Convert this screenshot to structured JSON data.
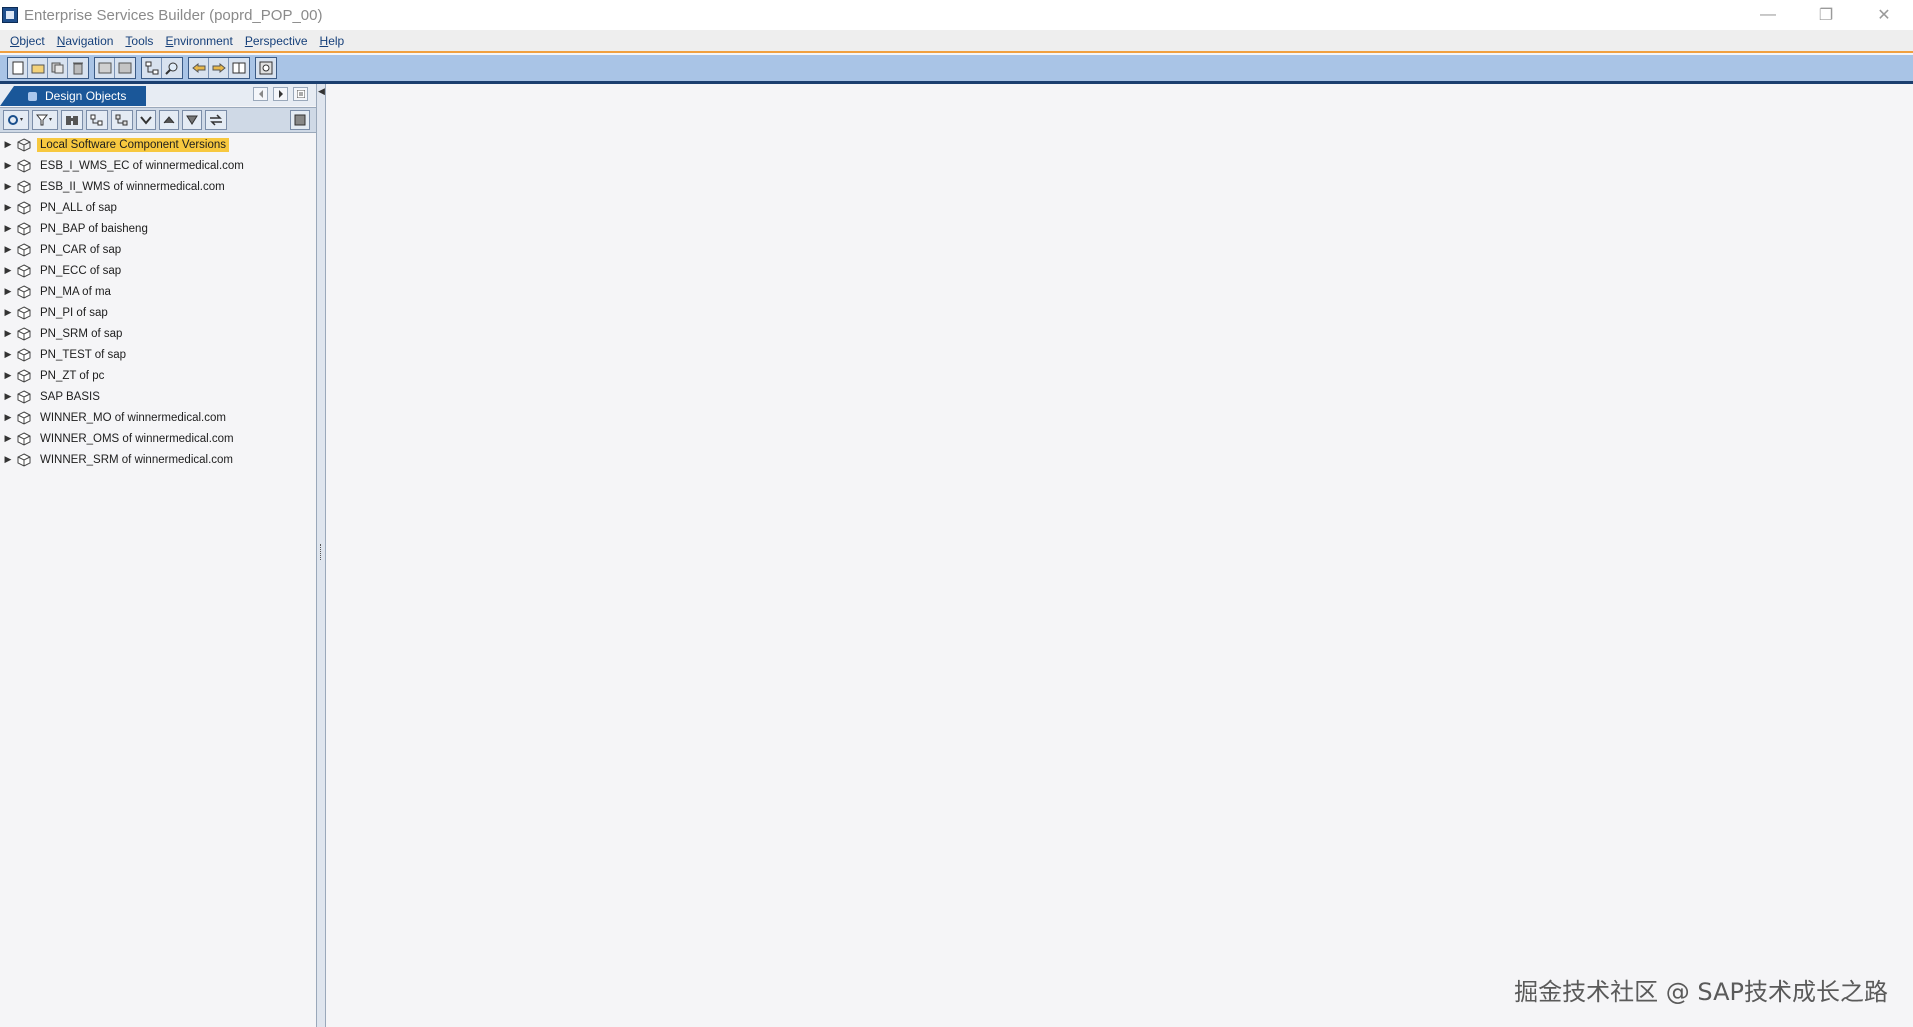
{
  "window": {
    "title": "Enterprise Services Builder (poprd_POP_00)",
    "minimize_symbol": "—",
    "restore_symbol": "❐",
    "close_symbol": "✕"
  },
  "menu": [
    {
      "first": "O",
      "rest": "bject"
    },
    {
      "first": "N",
      "rest": "avigation"
    },
    {
      "first": "T",
      "rest": "ools"
    },
    {
      "first": "E",
      "rest": "nvironment"
    },
    {
      "first": "P",
      "rest": "erspective"
    },
    {
      "first": "H",
      "rest": "elp"
    }
  ],
  "panel": {
    "tab_label": "Design Objects"
  },
  "tree": [
    {
      "label": "Local Software Component Versions",
      "selected": true
    },
    {
      "label": "ESB_I_WMS_EC of winnermedical.com"
    },
    {
      "label": "ESB_II_WMS of winnermedical.com"
    },
    {
      "label": "PN_ALL of sap"
    },
    {
      "label": "PN_BAP of baisheng"
    },
    {
      "label": "PN_CAR of sap"
    },
    {
      "label": "PN_ECC of sap"
    },
    {
      "label": "PN_MA of ma"
    },
    {
      "label": "PN_PI of sap"
    },
    {
      "label": "PN_SRM of sap"
    },
    {
      "label": "PN_TEST of sap"
    },
    {
      "label": "PN_ZT of pc"
    },
    {
      "label": "SAP BASIS"
    },
    {
      "label": "WINNER_MO of winnermedical.com"
    },
    {
      "label": "WINNER_OMS of winnermedical.com"
    },
    {
      "label": "WINNER_SRM of winnermedical.com"
    }
  ],
  "watermark": "掘金技术社区 @ SAP技术成长之路"
}
